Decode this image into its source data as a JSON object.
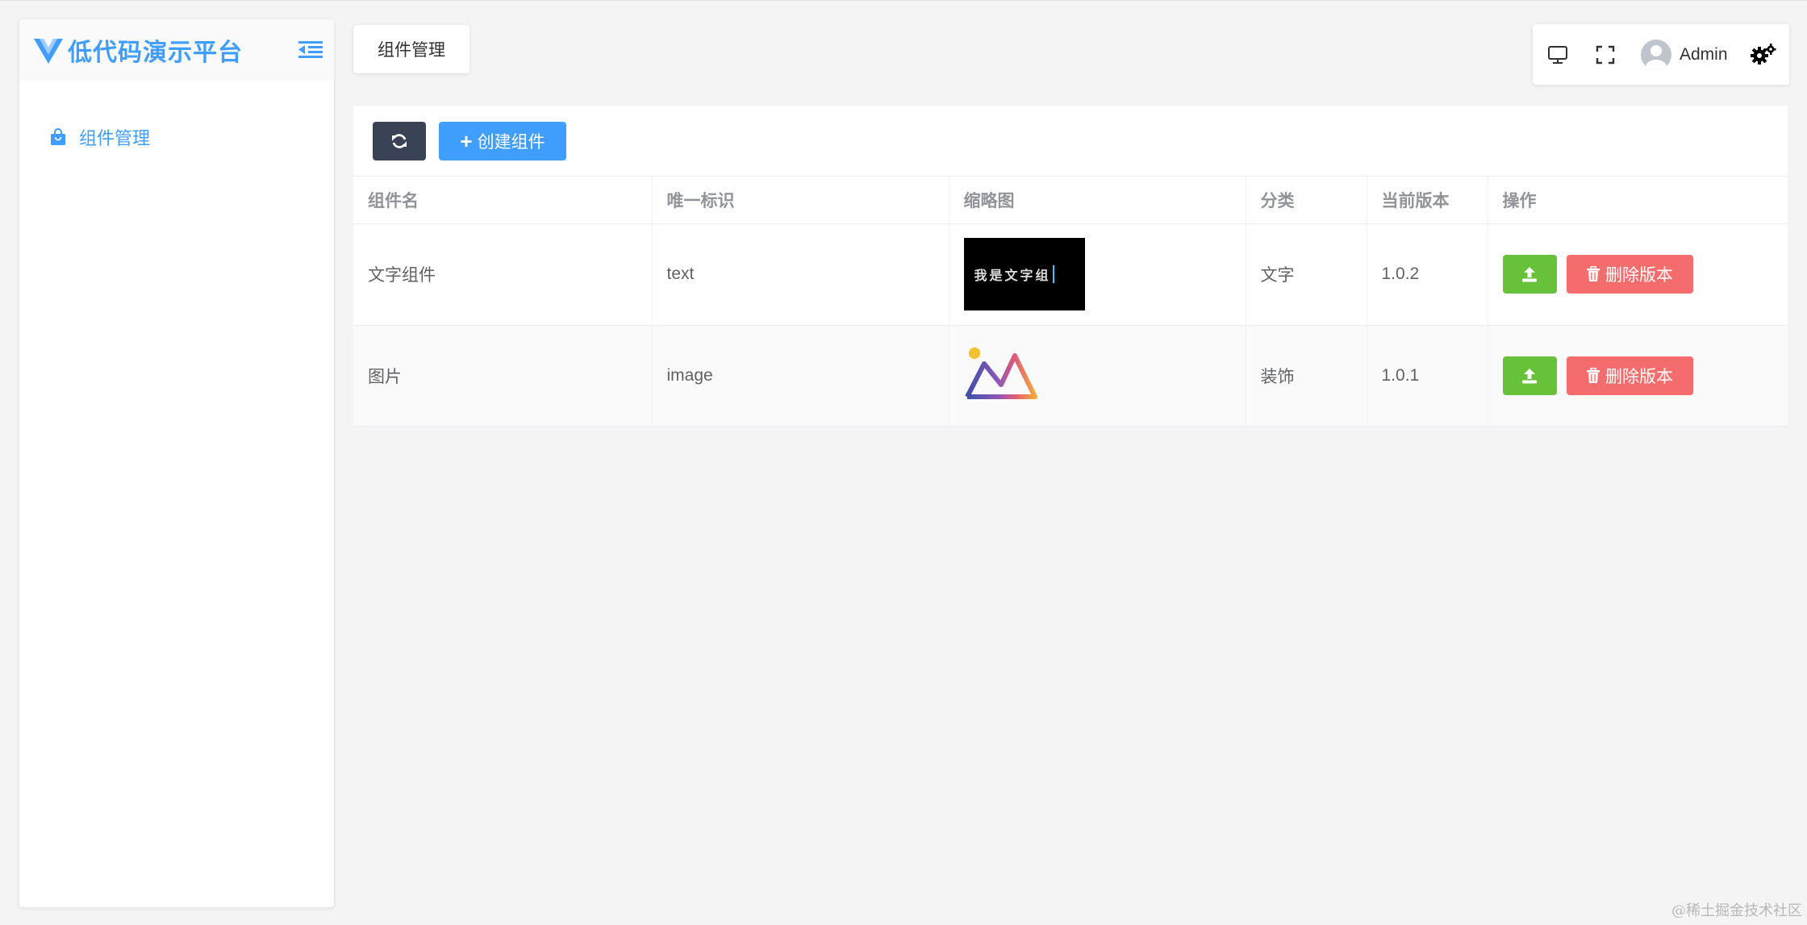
{
  "app": {
    "title": "低代码演示平台",
    "logo_icon": "vue-logo-icon",
    "accent": "#409eff"
  },
  "sidebar": {
    "items": [
      {
        "label": "组件管理",
        "icon": "shopping-bag-icon",
        "active": true
      }
    ]
  },
  "header": {
    "tabs": [
      {
        "label": "组件管理"
      }
    ],
    "user": {
      "name": "Admin"
    },
    "icons": [
      "monitor-icon",
      "fullscreen-icon",
      "avatar",
      "settings-gears-icon"
    ]
  },
  "toolbar": {
    "refresh_icon": "refresh-icon",
    "create_label": "创建组件",
    "create_icon": "plus-icon"
  },
  "table": {
    "columns": [
      "组件名",
      "唯一标识",
      "缩略图",
      "分类",
      "当前版本",
      "操作"
    ],
    "rows": [
      {
        "name": "文字组件",
        "id": "text",
        "thumbnail_text": "我是文字组",
        "category": "文字",
        "version": "1.0.2",
        "delete_label": "删除版本"
      },
      {
        "name": "图片",
        "id": "image",
        "thumbnail_icon": "image-mountain-icon",
        "category": "装饰",
        "version": "1.0.1",
        "delete_label": "删除版本"
      }
    ]
  },
  "colors": {
    "primary": "#409eff",
    "success": "#67c23a",
    "danger": "#f56c6c",
    "dark": "#3a4356"
  },
  "watermark": "@稀土掘金技术社区"
}
